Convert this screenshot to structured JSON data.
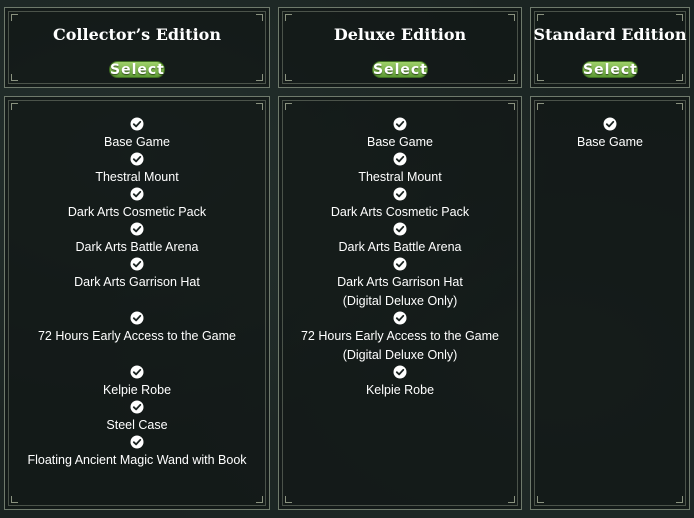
{
  "editions": [
    {
      "title": "Collector’s Edition",
      "select_label": "Select",
      "features": [
        "Base Game",
        "Thestral Mount",
        "Dark Arts Cosmetic Pack",
        "Dark Arts Battle Arena",
        "Dark Arts Garrison Hat",
        "72 Hours Early Access to the Game",
        "Kelpie Robe",
        "Steel Case",
        "Floating Ancient Magic Wand with Book"
      ]
    },
    {
      "title": "Deluxe Edition",
      "select_label": "Select",
      "features": [
        "Base Game",
        "Thestral Mount",
        "Dark Arts Cosmetic Pack",
        "Dark Arts Battle Arena",
        "Dark Arts Garrison Hat",
        "(Digital Deluxe Only)",
        "72 Hours Early Access to the Game",
        "(Digital Deluxe Only)",
        "Kelpie Robe"
      ]
    },
    {
      "title": "Standard Edition",
      "select_label": "Select",
      "features": [
        "Base Game"
      ]
    }
  ],
  "colors": {
    "background": "#1b2422",
    "panel_border": "#6f7a6c",
    "select_button": "#7cb84b",
    "text": "#ffffff"
  },
  "icons": {
    "feature_check": "check-circle-icon"
  }
}
